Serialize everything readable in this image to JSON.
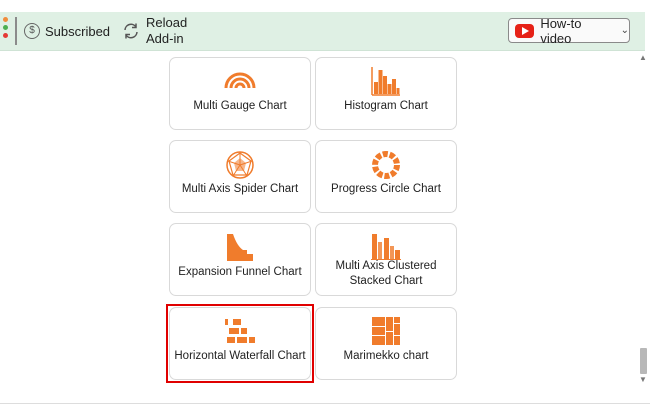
{
  "toolbar": {
    "subscribed_label": "Subscribed",
    "reload_label_1": "Reload",
    "reload_label_2": "Add-in",
    "howto_label": "How-to video",
    "dot_colors": [
      "#f08c3c",
      "#4caf50",
      "#e53935"
    ]
  },
  "charts": [
    {
      "label": "Multi Gauge Chart",
      "icon": "multi-gauge-icon"
    },
    {
      "label": "Histogram Chart",
      "icon": "histogram-icon"
    },
    {
      "label": "Multi Axis Spider Chart",
      "icon": "spider-icon"
    },
    {
      "label": "Progress Circle Chart",
      "icon": "progress-circle-icon"
    },
    {
      "label": "Expansion Funnel Chart",
      "icon": "expansion-funnel-icon"
    },
    {
      "label": "Multi Axis Clustered Stacked Chart",
      "icon": "clustered-stacked-icon"
    },
    {
      "label": "Horizontal Waterfall Chart",
      "icon": "horizontal-waterfall-icon",
      "selected": true
    },
    {
      "label": "Marimekko chart",
      "icon": "marimekko-icon"
    }
  ],
  "accent_color": "#f07c2c",
  "selection_color": "#e00000"
}
